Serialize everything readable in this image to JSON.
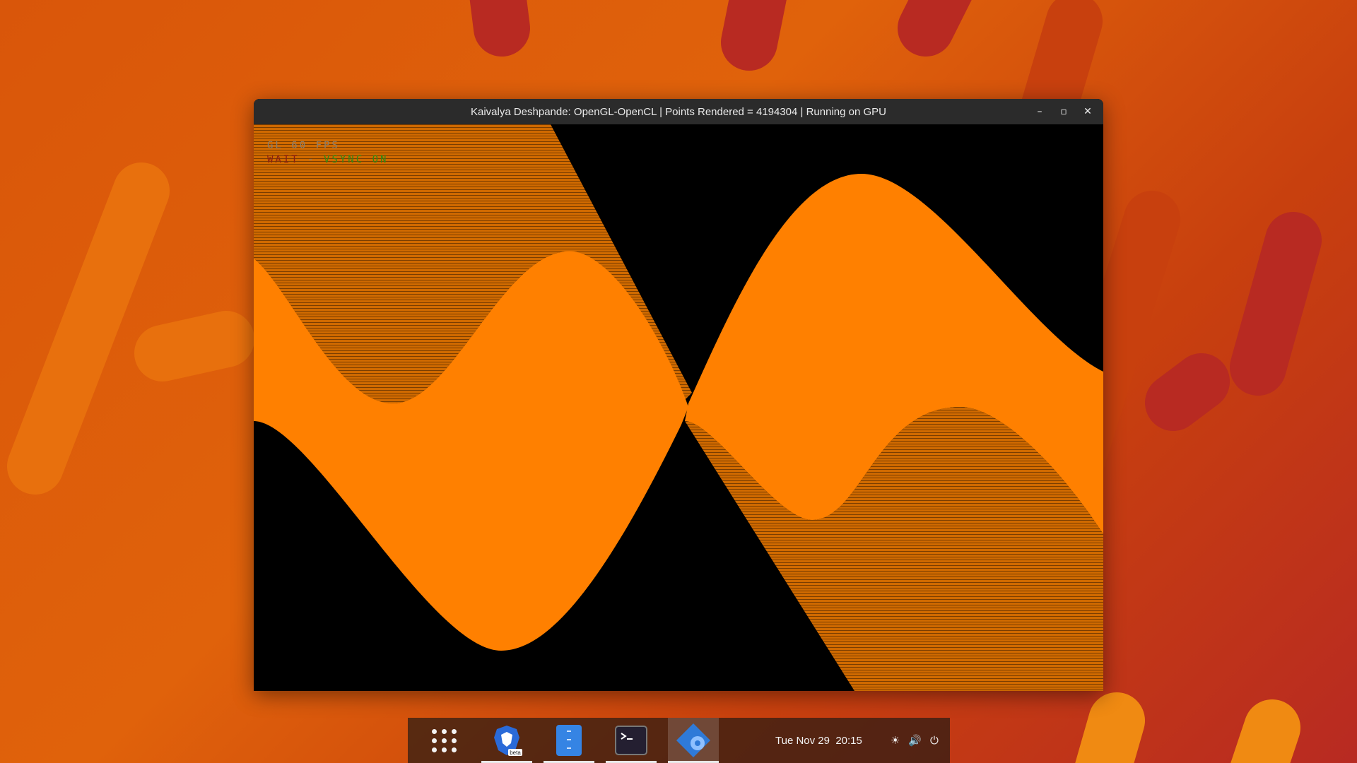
{
  "window": {
    "title": "Kaivalya Deshpande: OpenGL-OpenCL | Points Rendered = 4194304 | Running on GPU",
    "controls": {
      "minimize": "–",
      "maximize": "▫",
      "close": "✕"
    }
  },
  "hud": {
    "line1": "GL 60 FPS",
    "line2_red": "WAIT",
    "line2_sep": " - ",
    "line2_green": "VSYNC ON"
  },
  "colors": {
    "wave": "#ff8000",
    "canvas": "#000000"
  },
  "taskbar": {
    "apps": [
      {
        "name": "app-grid-icon",
        "active": false
      },
      {
        "name": "brave-beta-icon",
        "badge": "beta",
        "running": true
      },
      {
        "name": "files-icon",
        "running": true
      },
      {
        "name": "terminal-icon",
        "running": true
      },
      {
        "name": "settings-app-icon",
        "running": true,
        "active": true
      }
    ],
    "clock": "Tue Nov 29  20:15",
    "tray": [
      "brightness-icon",
      "volume-icon",
      "power-icon"
    ],
    "tray_glyphs": [
      "☀",
      "🔊",
      "⏻"
    ]
  }
}
